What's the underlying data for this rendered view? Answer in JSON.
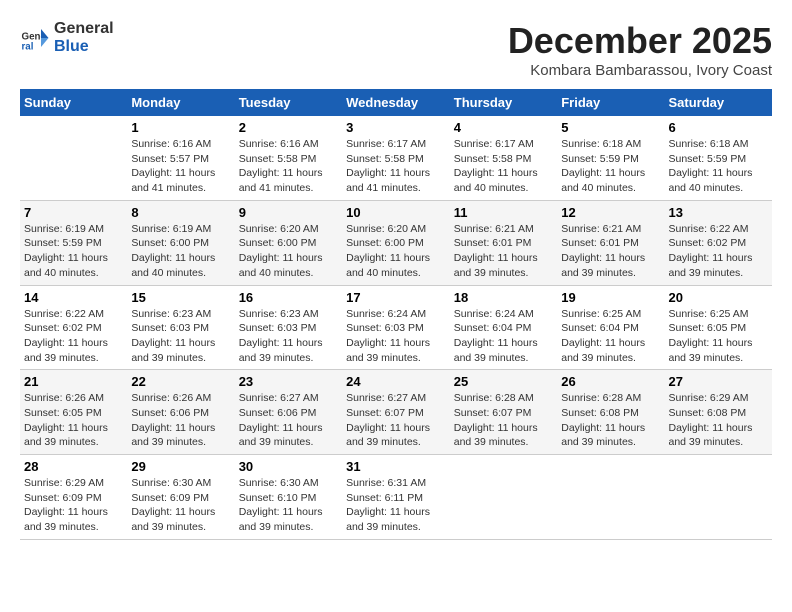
{
  "header": {
    "logo_line1": "General",
    "logo_line2": "Blue",
    "month": "December 2025",
    "location": "Kombara Bambarassou, Ivory Coast"
  },
  "weekdays": [
    "Sunday",
    "Monday",
    "Tuesday",
    "Wednesday",
    "Thursday",
    "Friday",
    "Saturday"
  ],
  "weeks": [
    [
      {
        "day": "",
        "info": ""
      },
      {
        "day": "1",
        "info": "Sunrise: 6:16 AM\nSunset: 5:57 PM\nDaylight: 11 hours\nand 41 minutes."
      },
      {
        "day": "2",
        "info": "Sunrise: 6:16 AM\nSunset: 5:58 PM\nDaylight: 11 hours\nand 41 minutes."
      },
      {
        "day": "3",
        "info": "Sunrise: 6:17 AM\nSunset: 5:58 PM\nDaylight: 11 hours\nand 41 minutes."
      },
      {
        "day": "4",
        "info": "Sunrise: 6:17 AM\nSunset: 5:58 PM\nDaylight: 11 hours\nand 40 minutes."
      },
      {
        "day": "5",
        "info": "Sunrise: 6:18 AM\nSunset: 5:59 PM\nDaylight: 11 hours\nand 40 minutes."
      },
      {
        "day": "6",
        "info": "Sunrise: 6:18 AM\nSunset: 5:59 PM\nDaylight: 11 hours\nand 40 minutes."
      }
    ],
    [
      {
        "day": "7",
        "info": "Sunrise: 6:19 AM\nSunset: 5:59 PM\nDaylight: 11 hours\nand 40 minutes."
      },
      {
        "day": "8",
        "info": "Sunrise: 6:19 AM\nSunset: 6:00 PM\nDaylight: 11 hours\nand 40 minutes."
      },
      {
        "day": "9",
        "info": "Sunrise: 6:20 AM\nSunset: 6:00 PM\nDaylight: 11 hours\nand 40 minutes."
      },
      {
        "day": "10",
        "info": "Sunrise: 6:20 AM\nSunset: 6:00 PM\nDaylight: 11 hours\nand 40 minutes."
      },
      {
        "day": "11",
        "info": "Sunrise: 6:21 AM\nSunset: 6:01 PM\nDaylight: 11 hours\nand 39 minutes."
      },
      {
        "day": "12",
        "info": "Sunrise: 6:21 AM\nSunset: 6:01 PM\nDaylight: 11 hours\nand 39 minutes."
      },
      {
        "day": "13",
        "info": "Sunrise: 6:22 AM\nSunset: 6:02 PM\nDaylight: 11 hours\nand 39 minutes."
      }
    ],
    [
      {
        "day": "14",
        "info": "Sunrise: 6:22 AM\nSunset: 6:02 PM\nDaylight: 11 hours\nand 39 minutes."
      },
      {
        "day": "15",
        "info": "Sunrise: 6:23 AM\nSunset: 6:03 PM\nDaylight: 11 hours\nand 39 minutes."
      },
      {
        "day": "16",
        "info": "Sunrise: 6:23 AM\nSunset: 6:03 PM\nDaylight: 11 hours\nand 39 minutes."
      },
      {
        "day": "17",
        "info": "Sunrise: 6:24 AM\nSunset: 6:03 PM\nDaylight: 11 hours\nand 39 minutes."
      },
      {
        "day": "18",
        "info": "Sunrise: 6:24 AM\nSunset: 6:04 PM\nDaylight: 11 hours\nand 39 minutes."
      },
      {
        "day": "19",
        "info": "Sunrise: 6:25 AM\nSunset: 6:04 PM\nDaylight: 11 hours\nand 39 minutes."
      },
      {
        "day": "20",
        "info": "Sunrise: 6:25 AM\nSunset: 6:05 PM\nDaylight: 11 hours\nand 39 minutes."
      }
    ],
    [
      {
        "day": "21",
        "info": "Sunrise: 6:26 AM\nSunset: 6:05 PM\nDaylight: 11 hours\nand 39 minutes."
      },
      {
        "day": "22",
        "info": "Sunrise: 6:26 AM\nSunset: 6:06 PM\nDaylight: 11 hours\nand 39 minutes."
      },
      {
        "day": "23",
        "info": "Sunrise: 6:27 AM\nSunset: 6:06 PM\nDaylight: 11 hours\nand 39 minutes."
      },
      {
        "day": "24",
        "info": "Sunrise: 6:27 AM\nSunset: 6:07 PM\nDaylight: 11 hours\nand 39 minutes."
      },
      {
        "day": "25",
        "info": "Sunrise: 6:28 AM\nSunset: 6:07 PM\nDaylight: 11 hours\nand 39 minutes."
      },
      {
        "day": "26",
        "info": "Sunrise: 6:28 AM\nSunset: 6:08 PM\nDaylight: 11 hours\nand 39 minutes."
      },
      {
        "day": "27",
        "info": "Sunrise: 6:29 AM\nSunset: 6:08 PM\nDaylight: 11 hours\nand 39 minutes."
      }
    ],
    [
      {
        "day": "28",
        "info": "Sunrise: 6:29 AM\nSunset: 6:09 PM\nDaylight: 11 hours\nand 39 minutes."
      },
      {
        "day": "29",
        "info": "Sunrise: 6:30 AM\nSunset: 6:09 PM\nDaylight: 11 hours\nand 39 minutes."
      },
      {
        "day": "30",
        "info": "Sunrise: 6:30 AM\nSunset: 6:10 PM\nDaylight: 11 hours\nand 39 minutes."
      },
      {
        "day": "31",
        "info": "Sunrise: 6:31 AM\nSunset: 6:11 PM\nDaylight: 11 hours\nand 39 minutes."
      },
      {
        "day": "",
        "info": ""
      },
      {
        "day": "",
        "info": ""
      },
      {
        "day": "",
        "info": ""
      }
    ]
  ]
}
